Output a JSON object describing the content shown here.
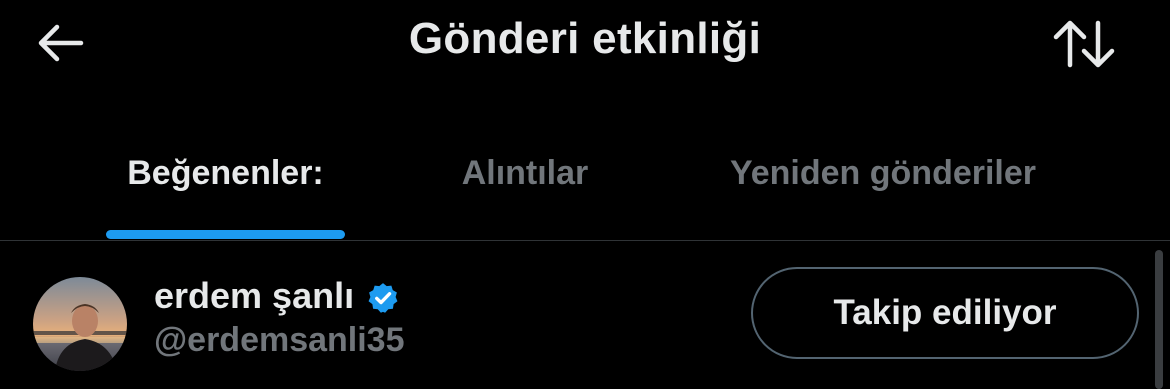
{
  "header": {
    "title": "Gönderi etkinliği",
    "back_icon": "arrow-left-icon",
    "sort_icon": "sort-up-down-icon"
  },
  "tabs": [
    {
      "label": "Beğenenler:",
      "active": true
    },
    {
      "label": "Alıntılar",
      "active": false
    },
    {
      "label": "Yeniden gönderiler",
      "active": false
    }
  ],
  "users": [
    {
      "name": "erdem şanlı",
      "handle": "@erdemsanli35",
      "verified": true,
      "follow_label": "Takip ediliyor"
    }
  ],
  "colors": {
    "background": "#000000",
    "text_primary": "#e7e9ea",
    "text_secondary": "#71767b",
    "accent": "#1d9bf0",
    "divider": "#2f3336",
    "button_border": "#536471"
  }
}
